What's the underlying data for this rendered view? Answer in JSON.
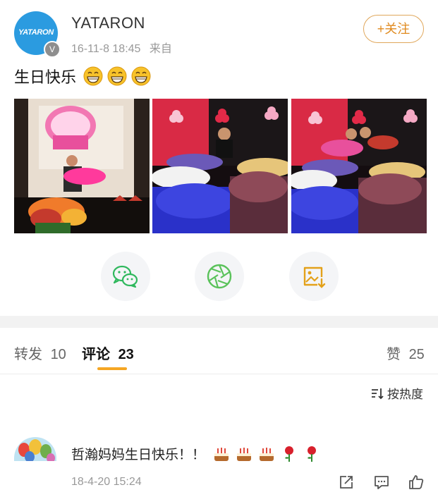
{
  "post": {
    "username": "YATARON",
    "avatar_logo": "YATARON",
    "verified_mark": "V",
    "timestamp": "16-11-8 18:45",
    "source": "来自",
    "follow_label": "+关注",
    "text": "生日快乐",
    "emoji_count": 3,
    "photo_count": 3
  },
  "share": {
    "buttons": [
      "wechat-icon",
      "moments-icon",
      "save-image-icon"
    ]
  },
  "tabs": {
    "repost_label": "转发",
    "repost_count": "10",
    "comment_label": "评论",
    "comment_count": "23",
    "like_label": "赞",
    "like_count": "25"
  },
  "sort": {
    "label": "按热度"
  },
  "comments": [
    {
      "text": "哲瀚妈妈生日快乐！！",
      "emojis": [
        "cake",
        "cake",
        "cake",
        "rose",
        "rose"
      ],
      "time": "18-4-20 15:24"
    }
  ],
  "colors": {
    "accent": "#f5a623",
    "follow": "#e08a1e",
    "avatar_bg": "#2b9be0",
    "wechat": "#2fb85d",
    "moments": "#5ac25a",
    "save": "#e3a11a"
  }
}
